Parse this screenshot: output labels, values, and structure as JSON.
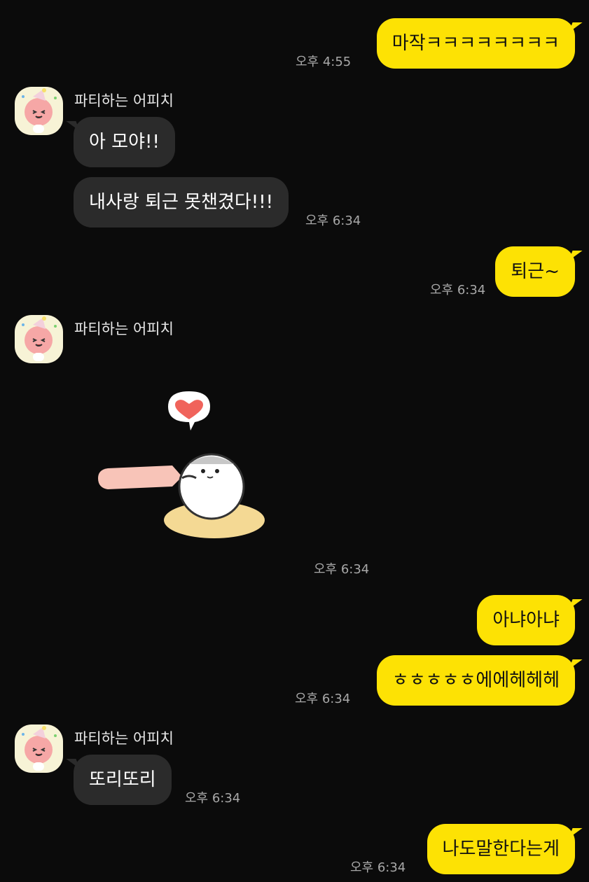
{
  "messages": [
    {
      "text": "마작ㅋㅋㅋㅋㅋㅋㅋㅋ",
      "time": "오후 4:55"
    },
    {
      "sender": "파티하는 어피치",
      "text": "아 모야!!"
    },
    {
      "text": "내사랑 퇴근 못챈겼다!!!",
      "time": "오후 6:34"
    },
    {
      "text": "퇴근~",
      "time": "오후 6:34"
    },
    {
      "sender": "파티하는 어피치",
      "sticker": "hamster-heart-sticker",
      "time": "오후 6:34"
    },
    {
      "text": "아냐아냐"
    },
    {
      "text": "ㅎㅎㅎㅎㅎ에에헤헤헤",
      "time": "오후 6:34"
    },
    {
      "sender": "파티하는 어피치",
      "text": "또리또리",
      "time": "오후 6:34"
    },
    {
      "text": "나도말한다는게",
      "time": "오후 6:34"
    }
  ],
  "colors": {
    "background": "#0b0b0b",
    "outgoing_bubble": "#fde204",
    "incoming_bubble": "#2b2b2b"
  }
}
